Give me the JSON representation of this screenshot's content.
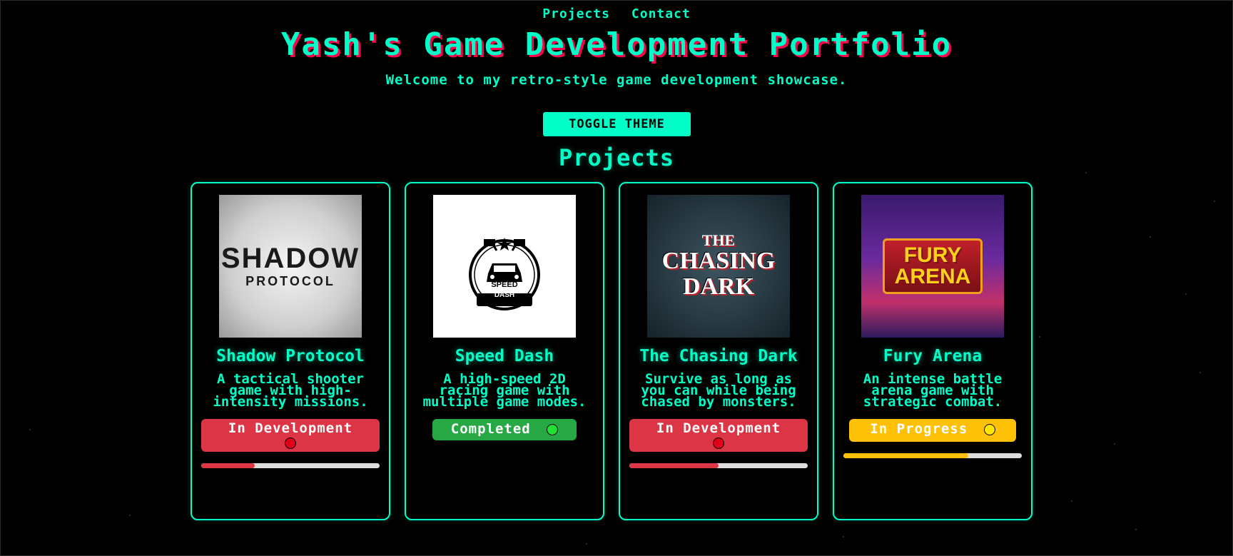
{
  "nav": {
    "projects": "Projects",
    "contact": "Contact"
  },
  "header": {
    "title": "Yash's Game Development Portfolio",
    "subtitle": "Welcome to my retro-style game development showcase.",
    "toggle_label": "TOGGLE THEME"
  },
  "projects_heading": "Projects",
  "colors": {
    "accent": "#00ffc8",
    "in_development": "#dc3545",
    "completed": "#28a745",
    "in_progress": "#ffc107"
  },
  "projects": [
    {
      "title": "Shadow Protocol",
      "description": "A tactical shooter game with high-intensity missions.",
      "status": "In Development",
      "progress": 0.3,
      "logo": {
        "line1": "SHADOW",
        "line2": "PROTOCOL"
      }
    },
    {
      "title": "Speed Dash",
      "description": "A high-speed 2D racing game with multiple game modes.",
      "status": "Completed",
      "progress": null,
      "logo": {
        "line1": "SPEED",
        "line2": "DASH"
      }
    },
    {
      "title": "The Chasing Dark",
      "description": "Survive as long as you can while being chased by monsters.",
      "status": "In Development",
      "progress": 0.5,
      "logo": {
        "line1": "THE",
        "line2": "CHASING",
        "line3": "DARK"
      }
    },
    {
      "title": "Fury Arena",
      "description": "An intense battle arena game with strategic combat.",
      "status": "In Progress",
      "progress": 0.7,
      "logo": {
        "line1": "FURY",
        "line2": "ARENA"
      }
    }
  ]
}
